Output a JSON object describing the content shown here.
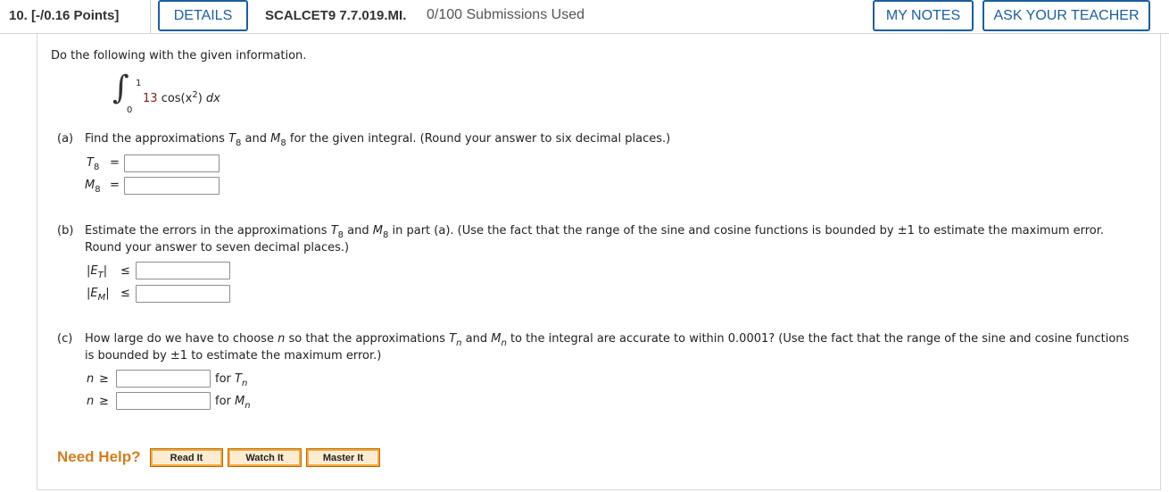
{
  "header": {
    "question_number": "10.",
    "points": "[-/0.16 Points]",
    "details_label": "DETAILS",
    "problem_code": "SCALCET9 7.7.019.MI.",
    "submissions": "0/100 Submissions Used",
    "my_notes_label": "MY NOTES",
    "ask_teacher_label": "ASK YOUR TEACHER",
    "accent_color": "#1a5fa0"
  },
  "problem": {
    "intro": "Do the following with the given information.",
    "integral": {
      "upper": "1",
      "lower": "0",
      "coefficient": "13",
      "func": "cos(x",
      "power": "2",
      "close": ")",
      "dx": "dx"
    },
    "part_a": {
      "label": "(a)",
      "text_1": "Find the approximations",
      "T": "T",
      "sub8": "8",
      "and": "and",
      "M": "M",
      "text_2": "for the given integral. (Round your answer to six decimal places.)",
      "rows": [
        {
          "var": "T",
          "sub": "8",
          "op": "=",
          "value": ""
        },
        {
          "var": "M",
          "sub": "8",
          "op": "=",
          "value": ""
        }
      ]
    },
    "part_b": {
      "label": "(b)",
      "text_1": "Estimate the errors in the approximations",
      "text_2": "in part (a). (Use the fact that the range of the sine and cosine functions is bounded by ±1 to estimate the maximum error.",
      "text_3": "Round your answer to seven decimal places.)",
      "rows": [
        {
          "bar_open": "|",
          "var": "E",
          "sub": "T",
          "bar_close": "|",
          "op": "≤",
          "value": ""
        },
        {
          "bar_open": "|",
          "var": "E",
          "sub": "M",
          "bar_close": "|",
          "op": "≤",
          "value": ""
        }
      ]
    },
    "part_c": {
      "label": "(c)",
      "text_1": "How large do we have to choose",
      "n": "n",
      "text_2": "so that the approximations",
      "text_3": "to the integral are accurate to within 0.0001? (Use the fact that the range of the sine and cosine functions",
      "text_4": "is bounded by ±1 to estimate the maximum error.)",
      "rows": [
        {
          "var": "n",
          "op": "≥",
          "for": "for",
          "target": "T",
          "target_sub": "n",
          "value": ""
        },
        {
          "var": "n",
          "op": "≥",
          "for": "for",
          "target": "M",
          "target_sub": "n",
          "value": ""
        }
      ]
    }
  },
  "help": {
    "label": "Need Help?",
    "buttons": [
      "Read It",
      "Watch It",
      "Master It"
    ],
    "label_color": "#d27e1e",
    "button_color": "#f7a93a"
  }
}
